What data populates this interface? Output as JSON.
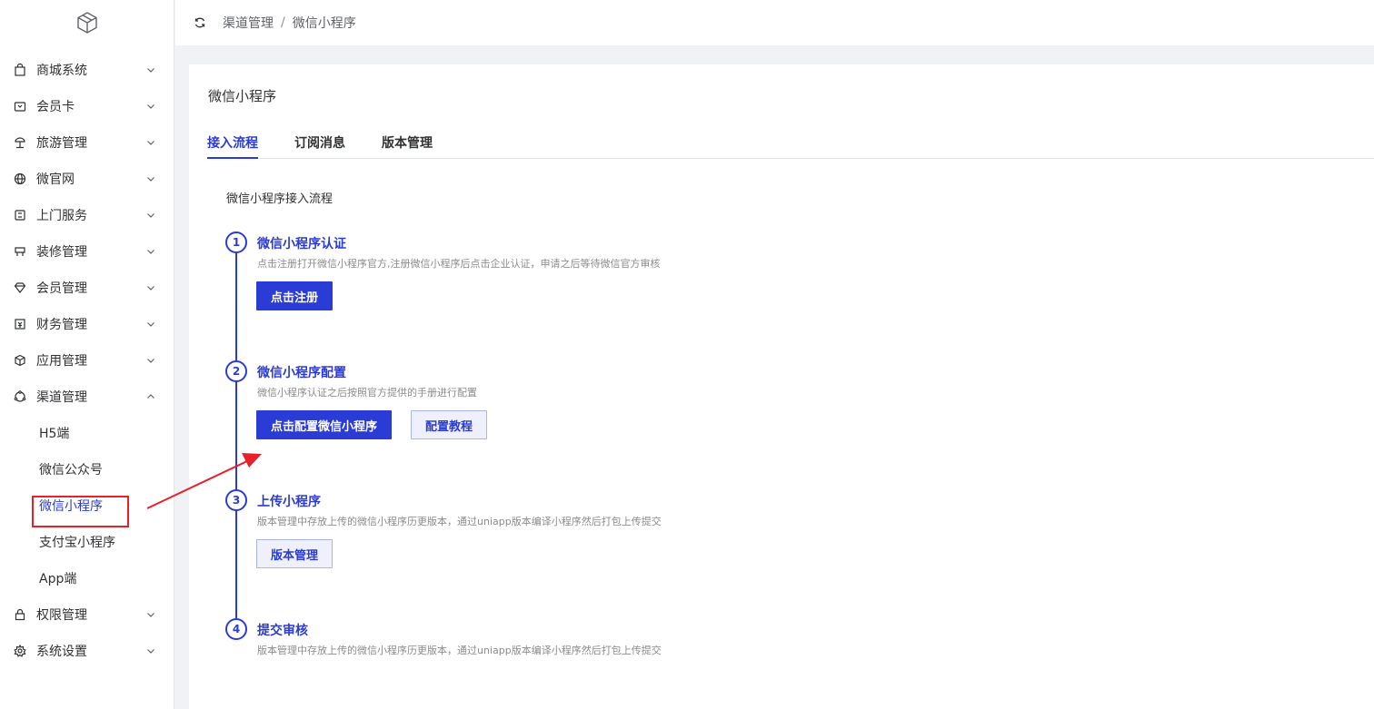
{
  "breadcrumb": {
    "parent": "渠道管理",
    "separator": "/",
    "current": "微信小程序"
  },
  "sidebar": {
    "items": [
      {
        "label": "商城系统",
        "icon": "shopping-bag-icon"
      },
      {
        "label": "会员卡",
        "icon": "card-icon"
      },
      {
        "label": "旅游管理",
        "icon": "beach-umbrella-icon"
      },
      {
        "label": "微官网",
        "icon": "globe-icon"
      },
      {
        "label": "上门服务",
        "icon": "service-icon"
      },
      {
        "label": "装修管理",
        "icon": "decoration-icon"
      },
      {
        "label": "会员管理",
        "icon": "diamond-icon"
      },
      {
        "label": "财务管理",
        "icon": "finance-icon"
      },
      {
        "label": "应用管理",
        "icon": "cube-icon"
      },
      {
        "label": "渠道管理",
        "icon": "channel-icon",
        "expanded": true
      },
      {
        "label": "权限管理",
        "icon": "lock-icon"
      },
      {
        "label": "系统设置",
        "icon": "gear-icon"
      }
    ],
    "sub_items": [
      {
        "label": "H5端"
      },
      {
        "label": "微信公众号"
      },
      {
        "label": "微信小程序",
        "active": true
      },
      {
        "label": "支付宝小程序"
      },
      {
        "label": "App端"
      }
    ]
  },
  "page": {
    "title": "微信小程序",
    "tabs": [
      {
        "label": "接入流程",
        "active": true
      },
      {
        "label": "订阅消息"
      },
      {
        "label": "版本管理"
      }
    ],
    "section_title": "微信小程序接入流程",
    "steps": [
      {
        "num": "1",
        "title": "微信小程序认证",
        "desc": "点击注册打开微信小程序官方,注册微信小程序后点击企业认证，申请之后等待微信官方审核",
        "buttons": [
          {
            "label": "点击注册",
            "style": "primary"
          }
        ]
      },
      {
        "num": "2",
        "title": "微信小程序配置",
        "desc": "微信小程序认证之后按照官方提供的手册进行配置",
        "buttons": [
          {
            "label": "点击配置微信小程序",
            "style": "primary"
          },
          {
            "label": "配置教程",
            "style": "plain"
          }
        ]
      },
      {
        "num": "3",
        "title": "上传小程序",
        "desc": "版本管理中存放上传的微信小程序历更版本，通过uniapp版本编译小程序然后打包上传提交",
        "buttons": [
          {
            "label": "版本管理",
            "style": "plain"
          }
        ]
      },
      {
        "num": "4",
        "title": "提交审核",
        "desc": "版本管理中存放上传的微信小程序历更版本，通过uniapp版本编译小程序然后打包上传提交",
        "buttons": []
      }
    ]
  },
  "colors": {
    "primary": "#2b3bd6",
    "annotation": "#e8202a"
  }
}
